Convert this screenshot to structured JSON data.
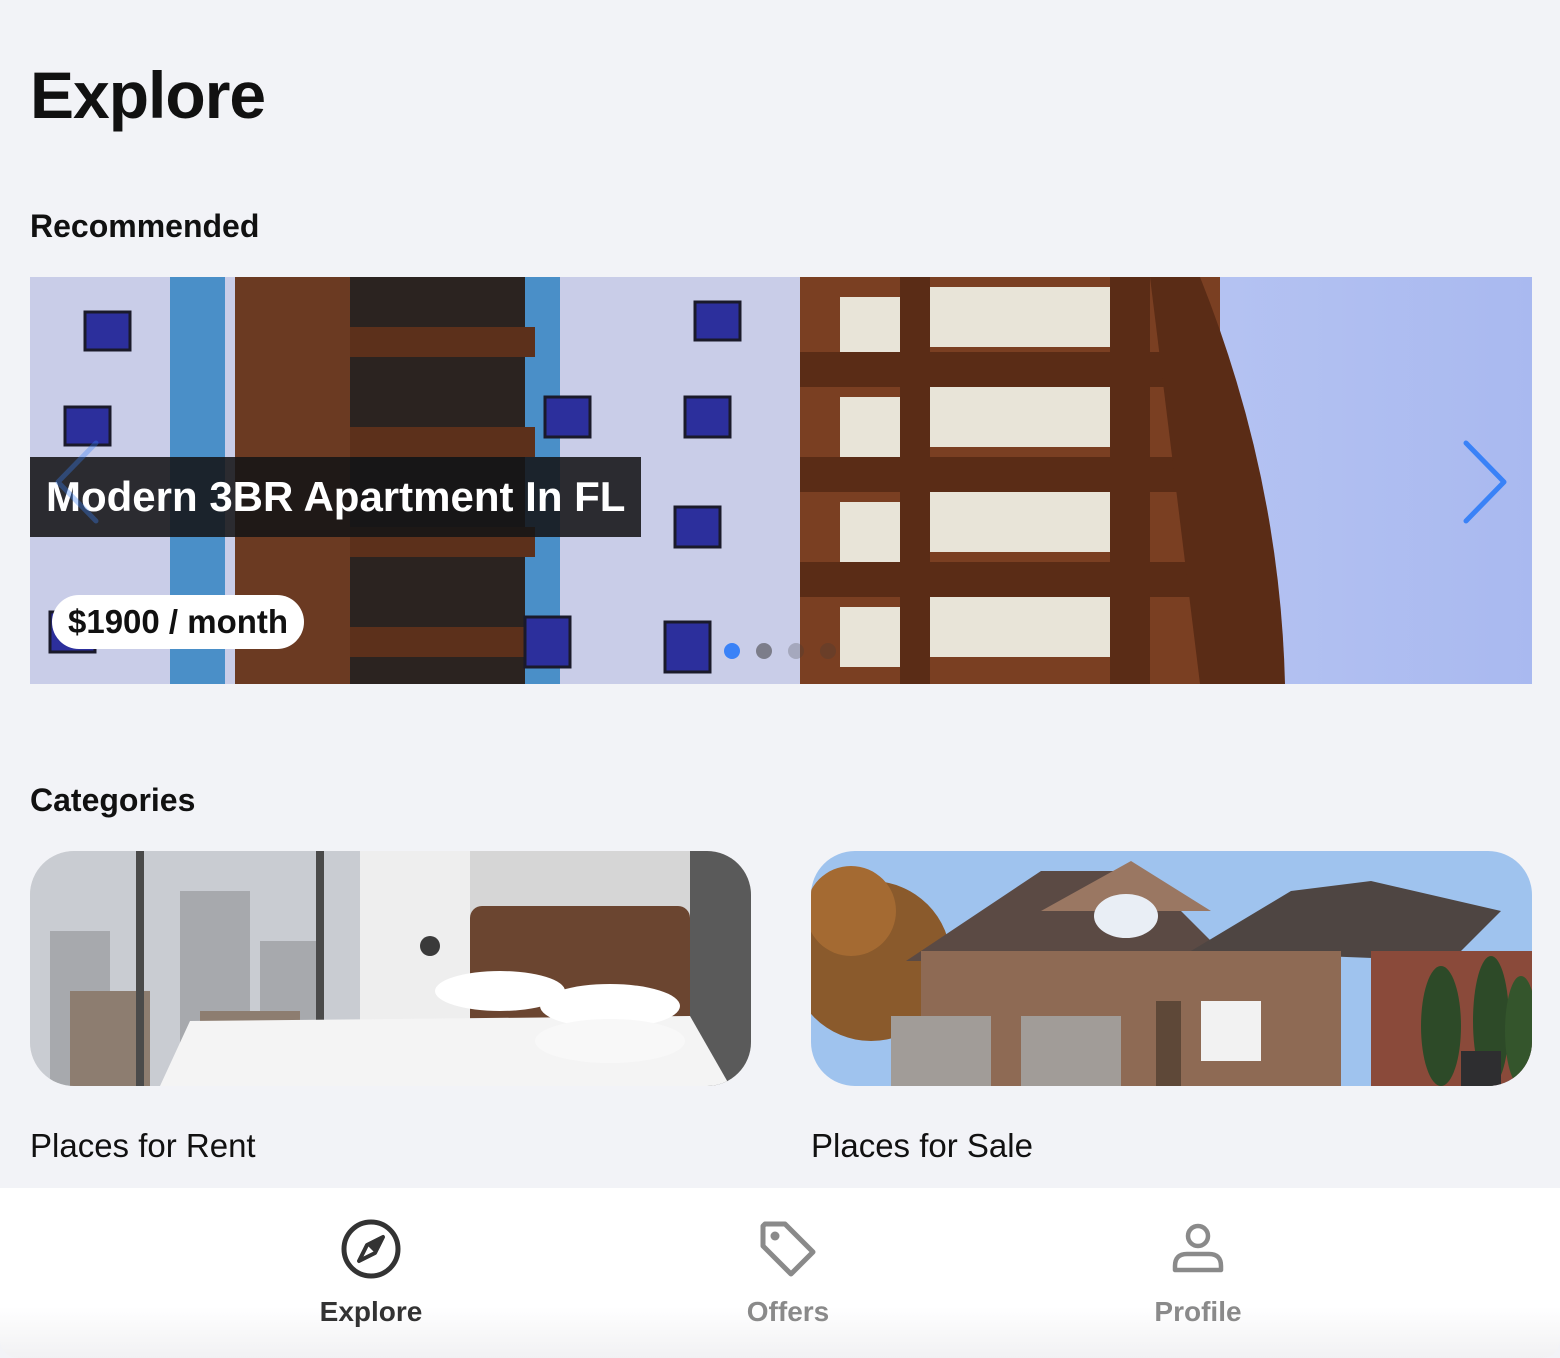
{
  "header": {
    "title": "Explore"
  },
  "recommended": {
    "section_title": "Recommended",
    "listing_title": "Modern 3BR Apartment In FL",
    "price": "$1900 / month",
    "slide_count": 4,
    "active_slide": 1,
    "colors": {
      "active_dot": "#3a82f7",
      "arrow": "#3a82f7"
    }
  },
  "categories": {
    "section_title": "Categories",
    "items": [
      {
        "label": "Places for Rent"
      },
      {
        "label": "Places for Sale"
      }
    ]
  },
  "tab_bar": {
    "tabs": [
      {
        "label": "Explore",
        "icon": "compass-icon",
        "active": true
      },
      {
        "label": "Offers",
        "icon": "tag-icon",
        "active": false
      },
      {
        "label": "Profile",
        "icon": "person-icon",
        "active": false
      }
    ]
  }
}
